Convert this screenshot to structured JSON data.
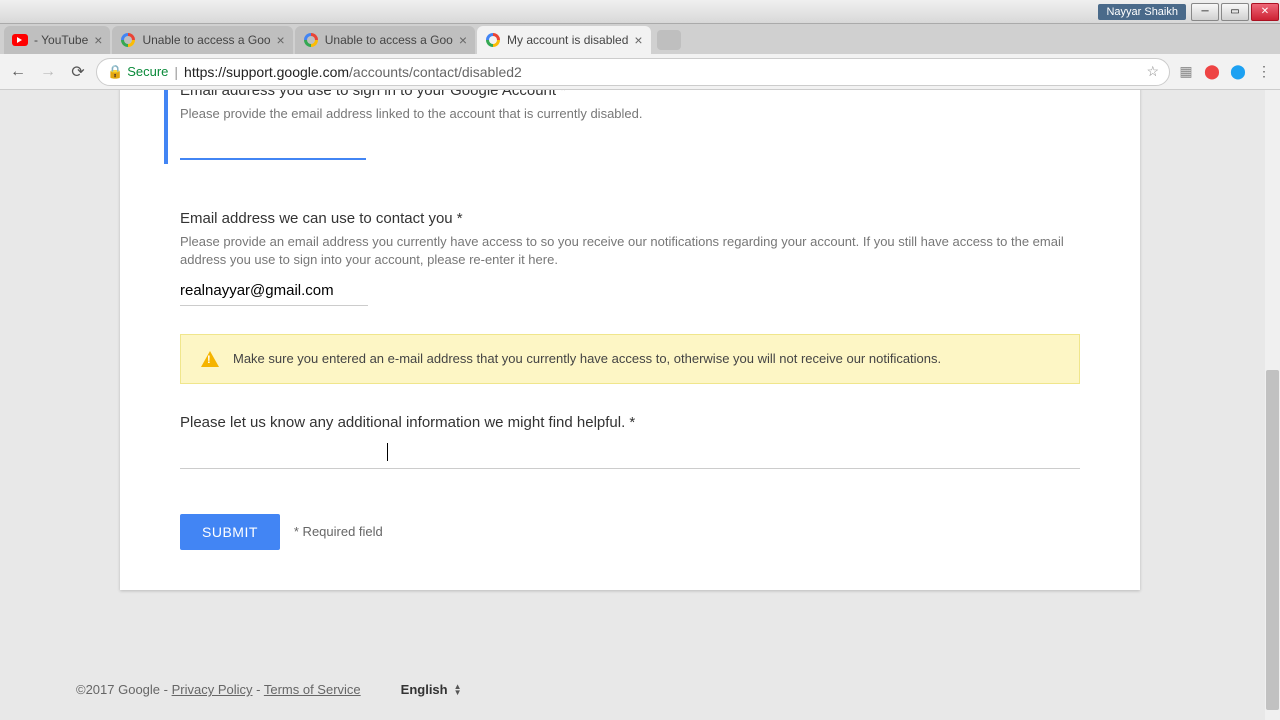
{
  "window": {
    "user": "Nayyar Shaikh"
  },
  "tabs": [
    {
      "title": "- YouTube",
      "type": "yt"
    },
    {
      "title": "Unable to access a Goo",
      "type": "g"
    },
    {
      "title": "Unable to access a Goo",
      "type": "g"
    },
    {
      "title": "My account is disabled ",
      "type": "g",
      "active": true
    }
  ],
  "addressbar": {
    "secure_label": "Secure",
    "host": "https://support.google.com",
    "path": "/accounts/contact/disabled2"
  },
  "form": {
    "field1": {
      "label": "Email address you use to sign in to your Google Account *",
      "desc": "Please provide the email address linked to the account that is currently disabled.",
      "value": ""
    },
    "field2": {
      "label": "Email address we can use to contact you *",
      "desc": "Please provide an email address you currently have access to so you receive our notifications regarding your account. If you still have access to the email address you use to sign into your account, please re-enter it here.",
      "value": "realnayyar@gmail.com"
    },
    "alert": "Make sure you entered an e-mail address that you currently have access to, otherwise you will not receive our notifications.",
    "field3": {
      "label": "Please let us know any additional information we might find helpful. *",
      "value": ""
    },
    "submit": "SUBMIT",
    "required_note": "* Required field"
  },
  "footer": {
    "copyright": "©2017 Google - ",
    "privacy": "Privacy Policy",
    "sep": " - ",
    "tos": "Terms of Service",
    "language": "English"
  }
}
